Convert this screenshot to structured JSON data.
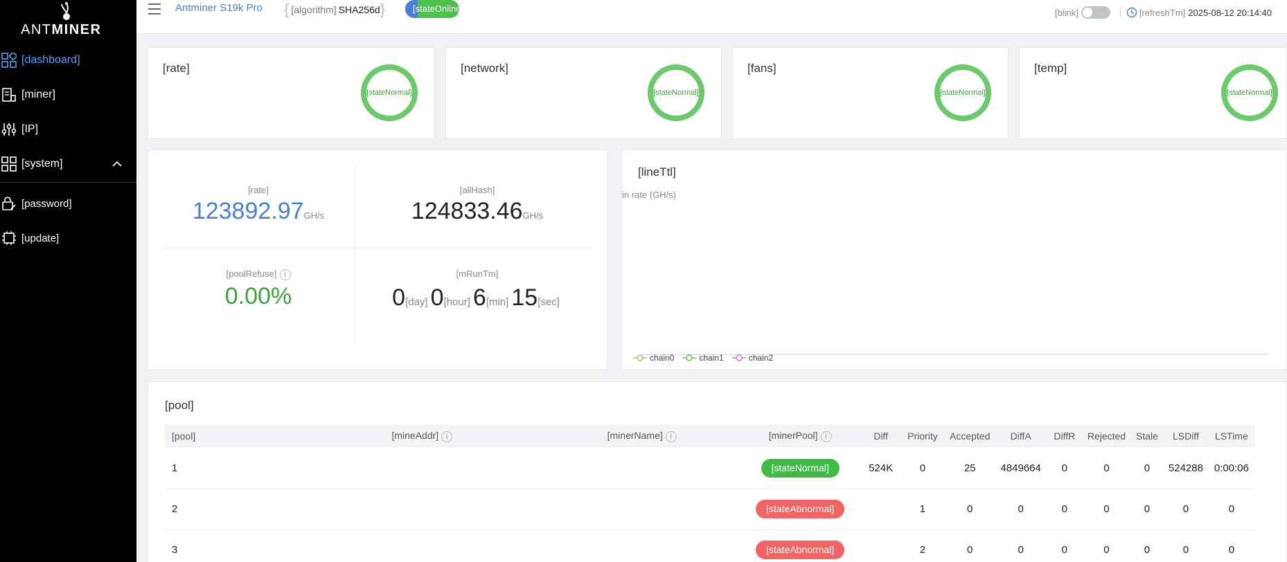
{
  "brand": {
    "logo_light": "ANT",
    "logo_bold": "MINER"
  },
  "sidebar": {
    "items": [
      {
        "label": "[dashboard]",
        "icon": "dashboard-icon",
        "active": true
      },
      {
        "label": "[miner]",
        "icon": "miner-icon"
      },
      {
        "label": "[IP]",
        "icon": "sliders-icon"
      },
      {
        "label": "[system]",
        "icon": "system-icon",
        "expanded": true
      },
      {
        "label": "[password]",
        "icon": "lock-icon"
      },
      {
        "label": "[update]",
        "icon": "chip-icon"
      }
    ]
  },
  "header": {
    "model": "Antminer S19k Pro",
    "algorithm_key": "[algorithm]",
    "algorithm_value": "SHA256d",
    "status": "[stateOnline]",
    "blink_label": "[blink]",
    "refresh_label": "[refreshTm]",
    "timestamp": "2025-08-12 20:14:40"
  },
  "status_cards": [
    {
      "title": "[rate]",
      "state": "[stateNormal]"
    },
    {
      "title": "[network]",
      "state": "[stateNormal]"
    },
    {
      "title": "[fans]",
      "state": "[stateNormal]"
    },
    {
      "title": "[temp]",
      "state": "[stateNormal]"
    }
  ],
  "metrics": {
    "rate_label": "[rate]",
    "rate_value": "123892.97",
    "rate_unit": "GH/s",
    "allhash_label": "[allHash]",
    "allhash_value": "124833.46",
    "allhash_unit": "GH/s",
    "poolrefuse_label": "[poolRefuse]",
    "poolrefuse_value": "0.00%",
    "runtime_label": "[mRunTm]",
    "runtime": {
      "day": "0",
      "day_unit": "[day]",
      "hour": "0",
      "hour_unit": "[hour]",
      "min": "6",
      "min_unit": "[min]",
      "sec": "15",
      "sec_unit": "[sec]"
    },
    "info_glyph": "i"
  },
  "chart_data": {
    "type": "line",
    "title": "[lineTtl]",
    "ylabel": "in rate (GH/s)",
    "series": [
      {
        "name": "chain0",
        "color": "#91cc75",
        "values": []
      },
      {
        "name": "chain1",
        "color": "#73c04b",
        "values": []
      },
      {
        "name": "chain2",
        "color": "#c77fd6",
        "values": []
      }
    ]
  },
  "pool": {
    "title": "[pool]",
    "columns": [
      "[pool]",
      "[mineAddr]",
      "[minerName]",
      "[minerPool]",
      "Diff",
      "Priority",
      "Accepted",
      "DiffA",
      "DiffR",
      "Rejected",
      "Stale",
      "LSDiff",
      "LSTime"
    ],
    "rows": [
      {
        "pool": "1",
        "addr": "",
        "name": "",
        "state": "[stateNormal]",
        "state_type": "ok",
        "diff": "524K",
        "priority": "0",
        "accepted": "25",
        "diffa": "4849664",
        "diffr": "0",
        "rejected": "0",
        "stale": "0",
        "lsdiff": "524288",
        "lstime": "0:00:06"
      },
      {
        "pool": "2",
        "addr": "",
        "name": "",
        "state": "[stateAbnormal]",
        "state_type": "bad",
        "diff": "",
        "priority": "1",
        "accepted": "0",
        "diffa": "0",
        "diffr": "0",
        "rejected": "0",
        "stale": "0",
        "lsdiff": "0",
        "lstime": "0"
      },
      {
        "pool": "3",
        "addr": "",
        "name": "",
        "state": "[stateAbnormal]",
        "state_type": "bad",
        "diff": "",
        "priority": "2",
        "accepted": "0",
        "diffa": "0",
        "diffr": "0",
        "rejected": "0",
        "stale": "0",
        "lsdiff": "0",
        "lstime": "0"
      }
    ]
  },
  "colors": {
    "accent": "#4a7fd4",
    "active_nav": "#5b9df8",
    "ok": "#3fba45",
    "bad": "#f26363",
    "ring": "#6cc96c"
  }
}
